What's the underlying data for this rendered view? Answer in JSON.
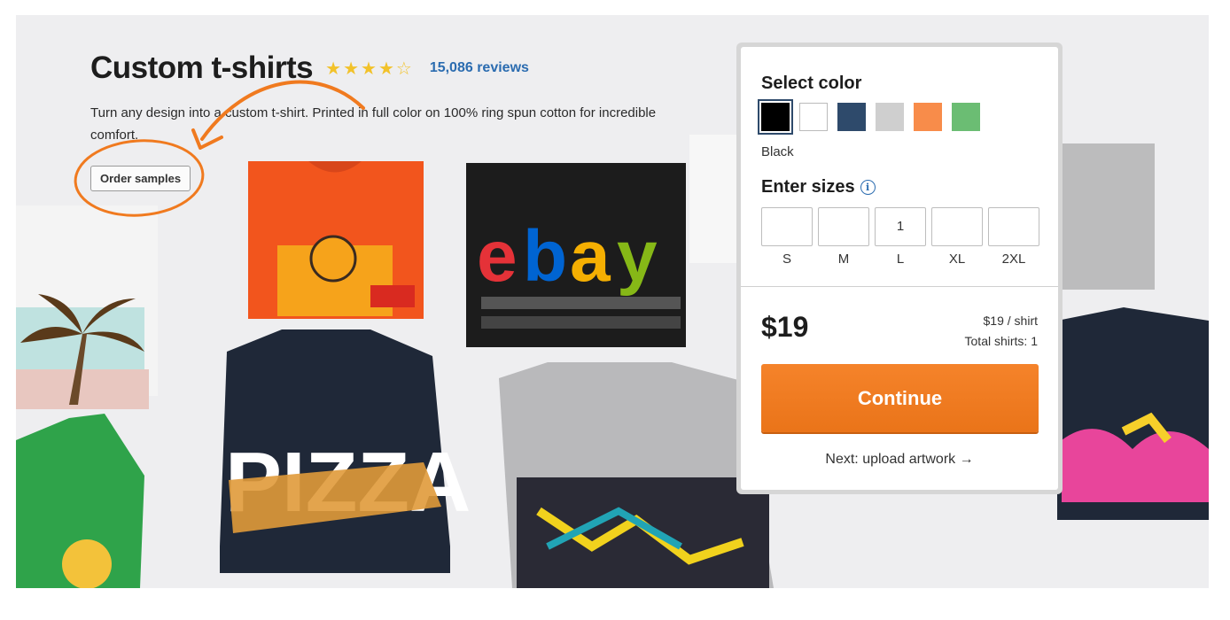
{
  "product": {
    "title": "Custom t-shirts",
    "rating_stars": 4.5,
    "reviews": "15,086 reviews",
    "description": "Turn any design into a custom t-shirt. Printed in full color on 100% ring spun cotton for incredible comfort.",
    "order_samples_label": "Order samples"
  },
  "panel": {
    "select_color_title": "Select color",
    "colors": [
      {
        "name": "Black",
        "hex": "#000000",
        "selected": true
      },
      {
        "name": "White",
        "hex": "#ffffff",
        "selected": false
      },
      {
        "name": "Navy",
        "hex": "#2e4a6b",
        "selected": false
      },
      {
        "name": "Gray",
        "hex": "#cfcfcf",
        "selected": false
      },
      {
        "name": "Orange",
        "hex": "#f88c4a",
        "selected": false
      },
      {
        "name": "Green",
        "hex": "#6bbd73",
        "selected": false
      }
    ],
    "selected_color": "Black",
    "enter_sizes_title": "Enter sizes",
    "sizes": [
      {
        "label": "S",
        "value": ""
      },
      {
        "label": "M",
        "value": ""
      },
      {
        "label": "L",
        "value": "1"
      },
      {
        "label": "XL",
        "value": ""
      },
      {
        "label": "2XL",
        "value": ""
      }
    ],
    "price": "$19",
    "price_per_shirt": "$19 / shirt",
    "total_shirts": "Total shirts: 1",
    "continue_label": "Continue",
    "next_link": "Next: upload artwork →"
  },
  "colors": {
    "accent_orange": "#f07a1f",
    "link_blue": "#2b6cb0",
    "star_yellow": "#f2c22a"
  },
  "shirt_prints": {
    "ebay": [
      "e",
      "b",
      "a",
      "y"
    ],
    "pizza": "PIZZA"
  }
}
